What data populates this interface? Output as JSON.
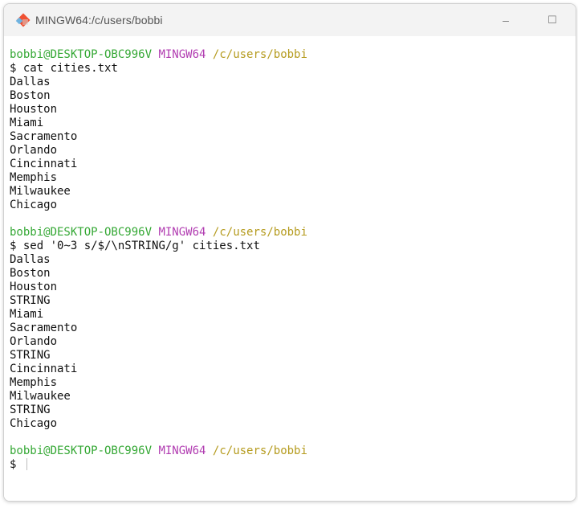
{
  "window": {
    "title": "MINGW64:/c/users/bobbi",
    "minimize_glyph": "–",
    "maximize_glyph": "☐",
    "icon": "git-bash-icon"
  },
  "terminal": {
    "prompt": {
      "user": "bobbi@DESKTOP-OBC996V",
      "shell": "MINGW64",
      "path": "/c/users/bobbi",
      "symbol": "$"
    },
    "colors": {
      "user": "#35a835",
      "shell": "#b13cb1",
      "path": "#b59b1e",
      "text": "#111111"
    },
    "blocks": [
      {
        "command": "cat cities.txt",
        "output": [
          "Dallas",
          "Boston",
          "Houston",
          "Miami",
          "Sacramento",
          "Orlando",
          "Cincinnati",
          "Memphis",
          "Milwaukee",
          "Chicago"
        ]
      },
      {
        "command": "sed '0~3 s/$/\\nSTRING/g' cities.txt",
        "output": [
          "Dallas",
          "Boston",
          "Houston",
          "STRING",
          "Miami",
          "Sacramento",
          "Orlando",
          "STRING",
          "Cincinnati",
          "Memphis",
          "Milwaukee",
          "STRING",
          "Chicago"
        ]
      },
      {
        "command": "",
        "output": []
      }
    ]
  }
}
